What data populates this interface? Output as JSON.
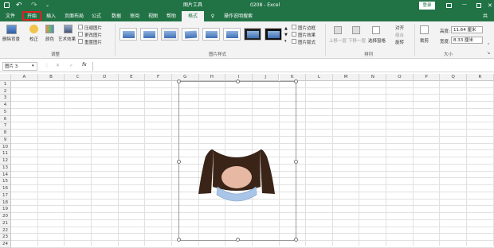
{
  "titlebar": {
    "file_name": "0208 - Excel",
    "context_tools": "图片工具",
    "login_label": "登录",
    "undo_icon": "↶",
    "redo_icon": "↷"
  },
  "tabs": [
    {
      "label": "文件"
    },
    {
      "label": "开始"
    },
    {
      "label": "插入"
    },
    {
      "label": "页面布局"
    },
    {
      "label": "公式"
    },
    {
      "label": "数据"
    },
    {
      "label": "审阅"
    },
    {
      "label": "视图"
    },
    {
      "label": "帮助"
    },
    {
      "label": "格式"
    }
  ],
  "tell_me": "操作说明搜索",
  "share_label": "共",
  "ribbon": {
    "adjust": {
      "remove_bg": "删除背景",
      "correct": "校正",
      "color": "颜色",
      "artistic": "艺术效果",
      "compress": "压缩图片",
      "change": "更改图片",
      "reset": "重置图片",
      "group_label": "调整"
    },
    "styles": {
      "group_label": "图片样式",
      "border": "图片边框",
      "effects": "图片效果",
      "layout": "图片版式"
    },
    "arrange": {
      "bring_forward": "上移一层",
      "send_backward": "下移一层",
      "selection_pane": "选择窗格",
      "align": "对齐",
      "group": "组合",
      "rotate": "旋转",
      "group_label": "排列"
    },
    "size": {
      "crop": "裁剪",
      "height_label": "高度:",
      "height_value": "11.64 厘米",
      "width_label": "宽度:",
      "width_value": "8.33 厘米",
      "group_label": "大小"
    }
  },
  "formula": {
    "name_box": "图片 3",
    "cancel": "✕",
    "enter": "✓",
    "fx": "fx"
  },
  "columns": [
    "A",
    "B",
    "C",
    "D",
    "E",
    "F",
    "G",
    "H",
    "I",
    "J",
    "K",
    "L",
    "M",
    "N",
    "O",
    "P",
    "Q",
    "R"
  ],
  "rows": [
    "1",
    "2",
    "3",
    "4",
    "5",
    "6",
    "7",
    "8",
    "9",
    "10",
    "11",
    "12",
    "13",
    "14",
    "15",
    "16",
    "17",
    "18",
    "19",
    "20",
    "21",
    "22",
    "23",
    "24"
  ],
  "colors": {
    "excel_green": "#217346",
    "highlight_red": "#e02020",
    "collar_blue": "#a9c6e8"
  }
}
